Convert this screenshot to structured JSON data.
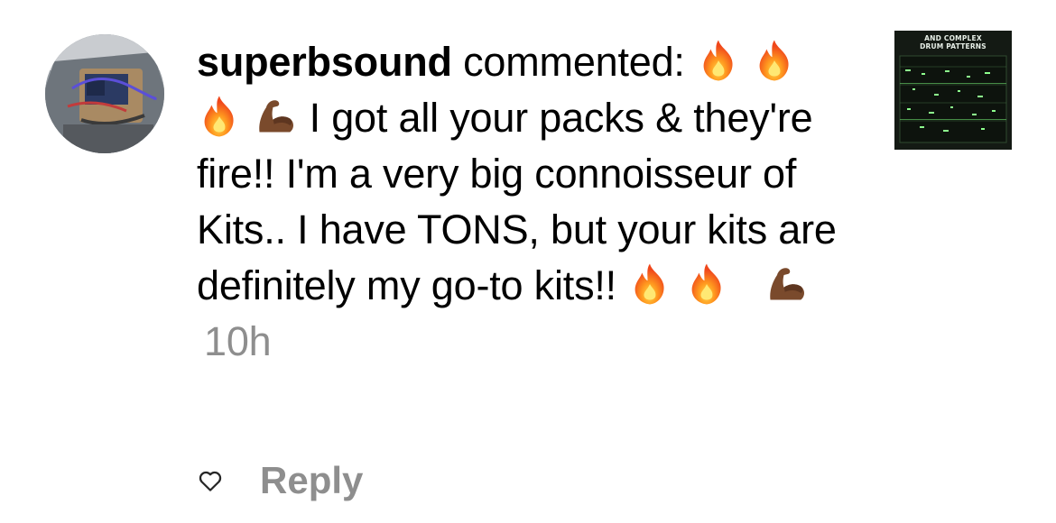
{
  "comment": {
    "username": "superbsound",
    "verb": "commented:",
    "text_1": " I got all your packs & they're fire!! I'm a very big connoisseur of Kits.. I have TONS, but your kits are definitely my go-to kits!! ",
    "timestamp": "10h"
  },
  "actions": {
    "reply_label": "Reply"
  },
  "thumbnail": {
    "title_line1": "AND COMPLEX",
    "title_line2": "DRUM PATTERNS"
  },
  "icons": {
    "fire": "fire-emoji",
    "flexed_biceps": "flexed-biceps-emoji-dark-skin",
    "heart": "heart-outline-icon"
  },
  "colors": {
    "text": "#000000",
    "muted": "#8e8e8e",
    "thumbnail_accent": "#8dff8d"
  }
}
